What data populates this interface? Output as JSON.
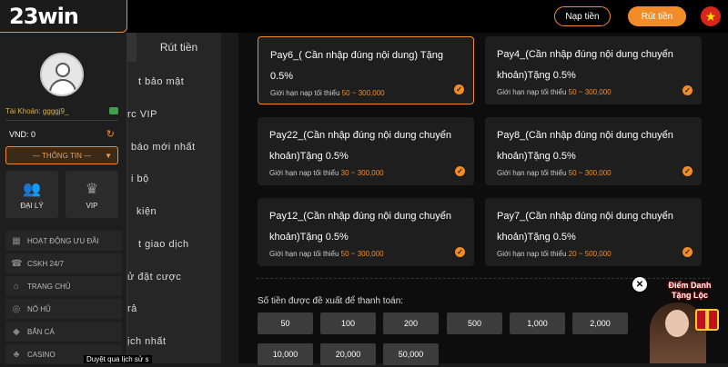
{
  "header": {
    "logo_text": "23win",
    "deposit_label": "Nạp tiền",
    "withdraw_label": "Rút tiền",
    "flag_icon": "vietnam-flag-icon"
  },
  "sidebar": {
    "account_label": "Tài Khoản: ggggj9_",
    "balance": "VND: 0",
    "info_select": "— THÔNG TIN —",
    "tiles": [
      {
        "label": "ĐẠI LÝ",
        "icon": "agent-icon"
      },
      {
        "label": "VIP",
        "icon": "vip-icon"
      }
    ],
    "menu": [
      {
        "label": "HOẠT ĐỘNG ƯU ĐÃI",
        "icon": "promo-icon"
      },
      {
        "label": "CSKH 24/7",
        "icon": "support-icon"
      },
      {
        "label": "TRANG CHỦ",
        "icon": "home-icon"
      },
      {
        "label": "NỔ HŨ",
        "icon": "slot-icon"
      },
      {
        "label": "BẮN CÁ",
        "icon": "fish-icon"
      },
      {
        "label": "CASINO",
        "icon": "casino-icon"
      }
    ]
  },
  "mid_menu": {
    "tab_label": "Rút tiền",
    "items": [
      "t bảo mật",
      "rc VIP",
      "báo mới nhất",
      "i bộ",
      "kiện",
      "t giao dịch",
      "ử đặt cược",
      "rả",
      "ịch nhất"
    ]
  },
  "payment_methods": [
    {
      "title": "Pay6_( Cần nhập đúng nội dung) Tặng 0.5%",
      "limit_prefix": "Giới hạn nạp tối thiểu",
      "min": "50",
      "max": "300,000",
      "selected": true
    },
    {
      "title": "Pay4_(Cần nhập đúng nội dung chuyển khoản)Tặng 0.5%",
      "limit_prefix": "Giới hạn nạp tối thiểu",
      "min": "50",
      "max": "300,000",
      "selected": false
    },
    {
      "title": "Pay22_(Cần nhập đúng nội dung chuyển khoản)Tặng 0.5%",
      "limit_prefix": "Giới hạn nạp tối thiểu",
      "min": "30",
      "max": "300,000",
      "selected": false
    },
    {
      "title": "Pay8_(Cần nhập đúng nội dung chuyển khoản)Tặng 0.5%",
      "limit_prefix": "Giới hạn nạp tối thiểu",
      "min": "50",
      "max": "300,000",
      "selected": false
    },
    {
      "title": "Pay12_(Cần nhập đúng nội dung chuyển khoản)Tặng 0.5%",
      "limit_prefix": "Giới hạn nạp tối thiểu",
      "min": "50",
      "max": "300,000",
      "selected": false
    },
    {
      "title": "Pay7_(Cần nhập đúng nội dung chuyển khoản)Tặng 0.5%",
      "limit_prefix": "Giới hạn nạp tối thiểu",
      "min": "20",
      "max": "500,000",
      "selected": false
    }
  ],
  "suggest": {
    "label": "Số tiền được đề xuất để thanh toán:",
    "amounts": [
      "50",
      "100",
      "200",
      "500",
      "1,000",
      "2,000",
      "10,000",
      "20,000",
      "50,000"
    ]
  },
  "promo": {
    "text": "Điểm Danh Tặng Lộc"
  },
  "tooltip": "Duyệt qua lịch sử s",
  "colors": {
    "accent": "#f28c28",
    "bg": "#0d0d0d",
    "card": "#1e1e1e"
  }
}
